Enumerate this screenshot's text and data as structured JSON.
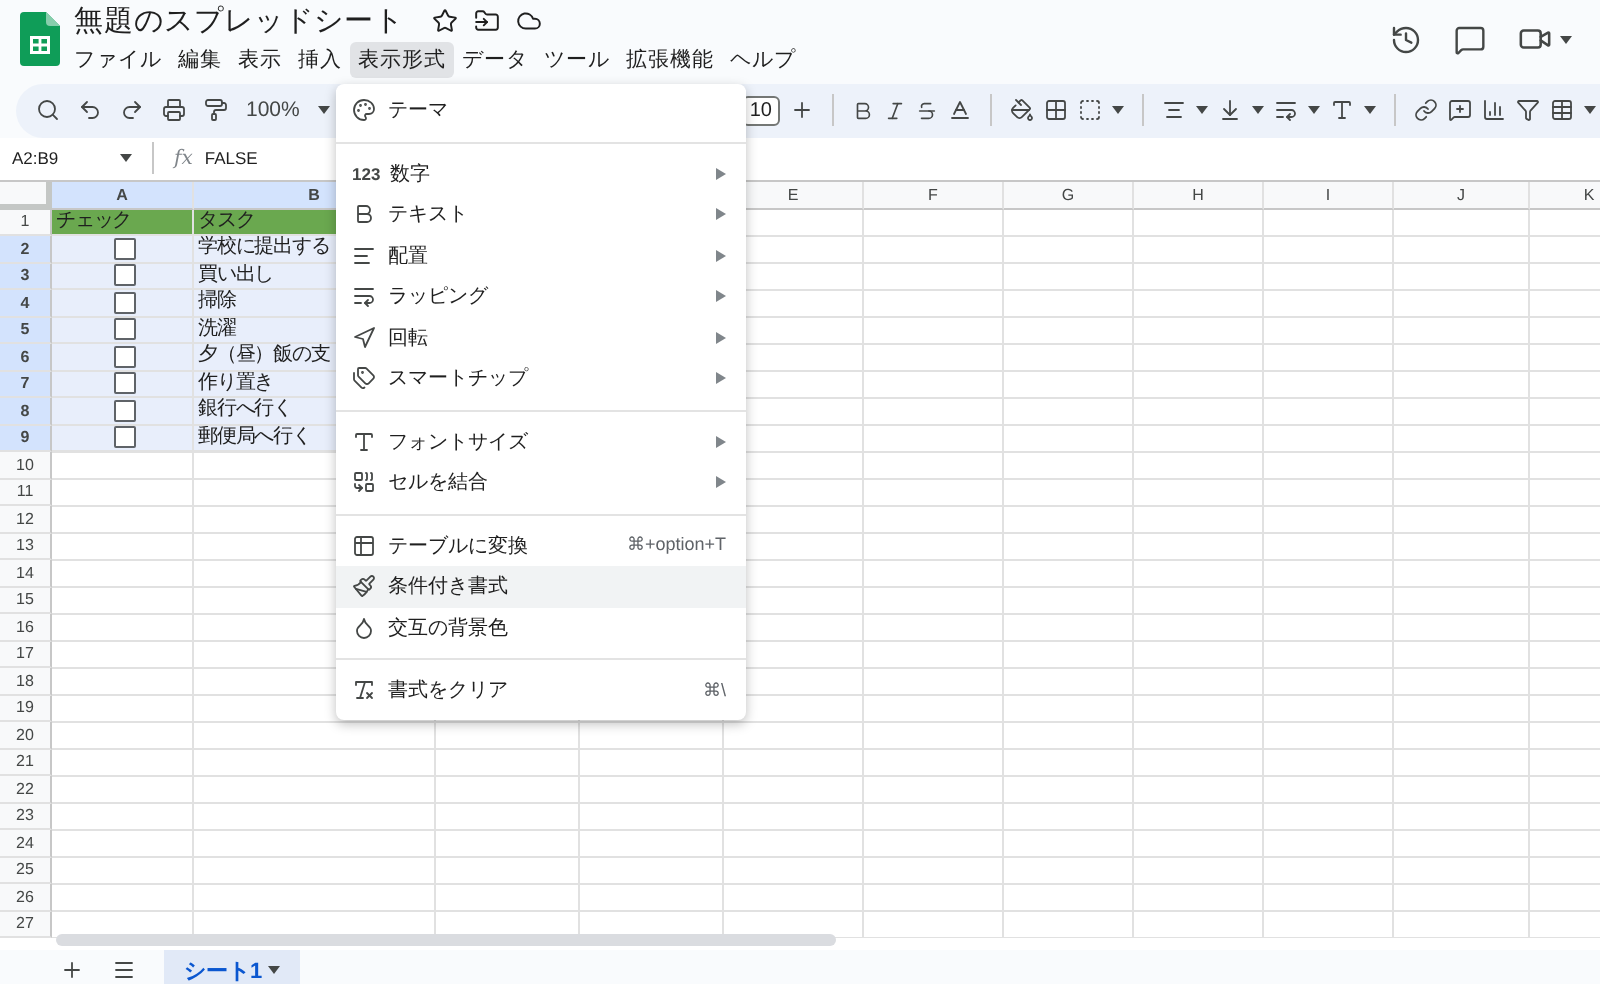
{
  "app": {
    "title": "無題のスプレッドシート"
  },
  "menu_bar": [
    {
      "label": "ファイル",
      "selected": false
    },
    {
      "label": "編集",
      "selected": false
    },
    {
      "label": "表示",
      "selected": false
    },
    {
      "label": "挿入",
      "selected": false
    },
    {
      "label": "表示形式",
      "selected": true
    },
    {
      "label": "データ",
      "selected": false
    },
    {
      "label": "ツール",
      "selected": false
    },
    {
      "label": "拡張機能",
      "selected": false
    },
    {
      "label": "ヘルプ",
      "selected": false
    }
  ],
  "toolbar": {
    "zoom": "100%",
    "font_size": "10"
  },
  "formula_bar": {
    "range": "A2:B9",
    "function_symbol": "fx",
    "formula": "FALSE"
  },
  "columns": [
    {
      "label": "A",
      "selected": true
    },
    {
      "label": "B",
      "selected": true
    },
    {
      "label": "E",
      "selected": false
    },
    {
      "label": "F",
      "selected": false
    },
    {
      "label": "G",
      "selected": false
    },
    {
      "label": "H",
      "selected": false
    },
    {
      "label": "I",
      "selected": false
    },
    {
      "label": "J",
      "selected": false
    },
    {
      "label": "K",
      "selected": false
    }
  ],
  "rows": [
    {
      "number": "1",
      "selected": false,
      "kind": "header",
      "cells": [
        "チェック",
        "タスク"
      ]
    },
    {
      "number": "2",
      "selected": true,
      "kind": "task",
      "checked": false,
      "task": "学校に提出する"
    },
    {
      "number": "3",
      "selected": true,
      "kind": "task",
      "checked": false,
      "task": "買い出し"
    },
    {
      "number": "4",
      "selected": true,
      "kind": "task",
      "checked": false,
      "task": "掃除"
    },
    {
      "number": "5",
      "selected": true,
      "kind": "task",
      "checked": false,
      "task": "洗濯"
    },
    {
      "number": "6",
      "selected": true,
      "kind": "task",
      "checked": false,
      "task": "夕（昼）飯の支"
    },
    {
      "number": "7",
      "selected": true,
      "kind": "task",
      "checked": false,
      "task": "作り置き"
    },
    {
      "number": "8",
      "selected": true,
      "kind": "task",
      "checked": false,
      "task": "銀行へ行く"
    },
    {
      "number": "9",
      "selected": true,
      "kind": "task",
      "checked": false,
      "task": "郵便局へ行く"
    },
    {
      "number": "10",
      "selected": false,
      "kind": "empty"
    },
    {
      "number": "11",
      "selected": false,
      "kind": "empty"
    },
    {
      "number": "12",
      "selected": false,
      "kind": "empty"
    },
    {
      "number": "13",
      "selected": false,
      "kind": "empty"
    },
    {
      "number": "14",
      "selected": false,
      "kind": "empty"
    },
    {
      "number": "15",
      "selected": false,
      "kind": "empty"
    },
    {
      "number": "16",
      "selected": false,
      "kind": "empty"
    },
    {
      "number": "17",
      "selected": false,
      "kind": "empty"
    },
    {
      "number": "18",
      "selected": false,
      "kind": "empty"
    },
    {
      "number": "19",
      "selected": false,
      "kind": "empty"
    },
    {
      "number": "20",
      "selected": false,
      "kind": "empty"
    },
    {
      "number": "21",
      "selected": false,
      "kind": "empty"
    },
    {
      "number": "22",
      "selected": false,
      "kind": "empty"
    },
    {
      "number": "23",
      "selected": false,
      "kind": "empty"
    },
    {
      "number": "24",
      "selected": false,
      "kind": "empty"
    },
    {
      "number": "25",
      "selected": false,
      "kind": "empty"
    },
    {
      "number": "26",
      "selected": false,
      "kind": "empty"
    },
    {
      "number": "27",
      "selected": false,
      "kind": "empty"
    }
  ],
  "format_menu": {
    "items": [
      {
        "kind": "item",
        "label": "テーマ",
        "highlighted": false
      },
      {
        "kind": "separator"
      },
      {
        "kind": "submenu",
        "icon_text": "123",
        "label": "数字",
        "highlighted": false
      },
      {
        "kind": "submenu",
        "label": "テキスト",
        "highlighted": false
      },
      {
        "kind": "submenu",
        "label": "配置",
        "highlighted": false
      },
      {
        "kind": "submenu",
        "label": "ラッピング",
        "highlighted": false
      },
      {
        "kind": "submenu",
        "label": "回転",
        "highlighted": false
      },
      {
        "kind": "submenu",
        "label": "スマートチップ",
        "highlighted": false
      },
      {
        "kind": "separator"
      },
      {
        "kind": "submenu",
        "label": "フォントサイズ",
        "highlighted": false
      },
      {
        "kind": "submenu",
        "label": "セルを結合",
        "highlighted": false
      },
      {
        "kind": "separator"
      },
      {
        "kind": "item",
        "label": "テーブルに変換",
        "shortcut": "⌘+option+T",
        "highlighted": false
      },
      {
        "kind": "item",
        "label": "条件付き書式",
        "highlighted": true
      },
      {
        "kind": "item",
        "label": "交互の背景色",
        "highlighted": false
      },
      {
        "kind": "separator"
      },
      {
        "kind": "item",
        "label": "書式をクリア",
        "shortcut": "⌘\\",
        "highlighted": false
      }
    ]
  },
  "sheet_tabs": [
    {
      "label": "シート1",
      "selected": true
    }
  ]
}
